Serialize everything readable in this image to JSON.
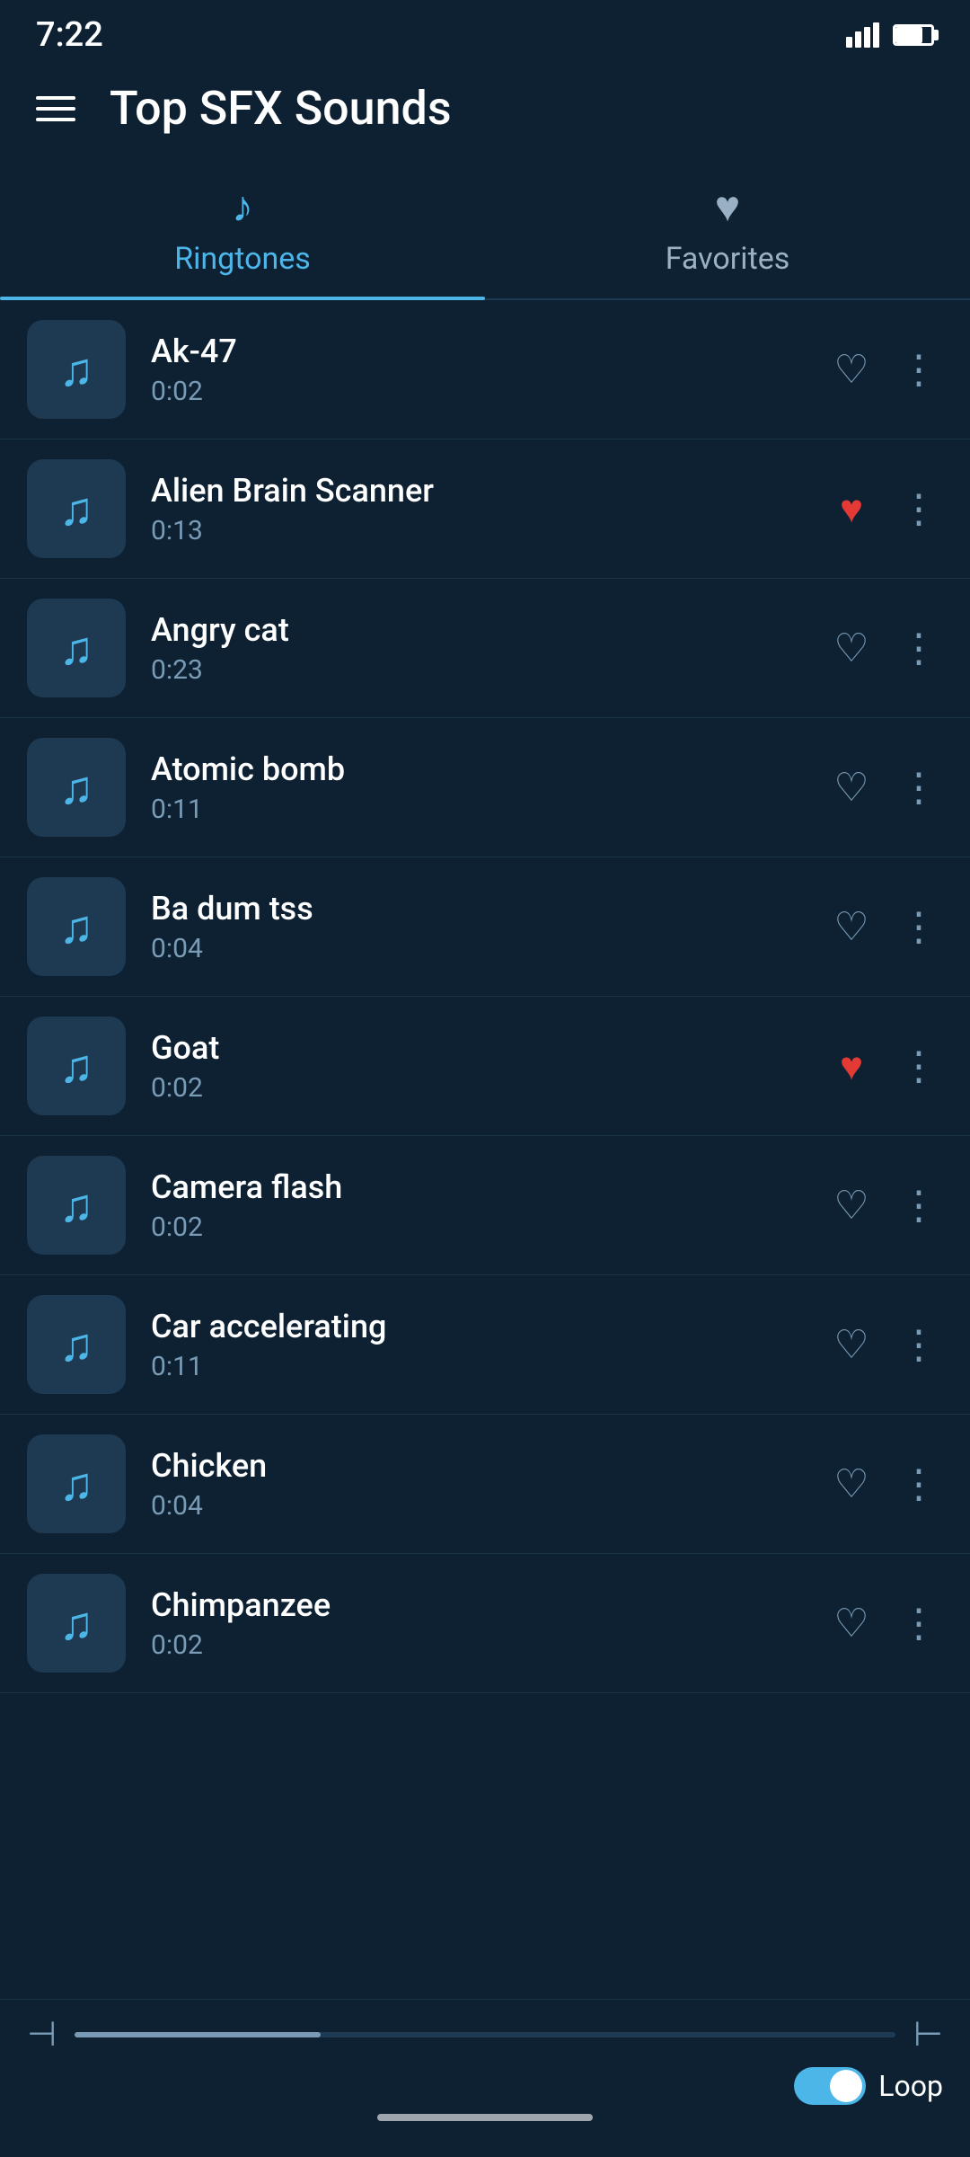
{
  "statusBar": {
    "time": "7:22"
  },
  "header": {
    "title": "Top SFX Sounds",
    "menuLabel": "menu"
  },
  "tabs": [
    {
      "id": "ringtones",
      "label": "Ringtones",
      "icon": "♪",
      "active": true
    },
    {
      "id": "favorites",
      "label": "Favorites",
      "icon": "♥",
      "active": false
    }
  ],
  "sounds": [
    {
      "name": "Ak-47",
      "duration": "0:02",
      "favorited": false
    },
    {
      "name": "Alien Brain Scanner",
      "duration": "0:13",
      "favorited": true
    },
    {
      "name": "Angry cat",
      "duration": "0:23",
      "favorited": false
    },
    {
      "name": "Atomic bomb",
      "duration": "0:11",
      "favorited": false
    },
    {
      "name": "Ba dum tss",
      "duration": "0:04",
      "favorited": false
    },
    {
      "name": "Goat",
      "duration": "0:02",
      "favorited": true
    },
    {
      "name": "Camera flash",
      "duration": "0:02",
      "favorited": false
    },
    {
      "name": "Car accelerating",
      "duration": "0:11",
      "favorited": false
    },
    {
      "name": "Chicken",
      "duration": "0:04",
      "favorited": false
    },
    {
      "name": "Chimpanzee",
      "duration": "0:02",
      "favorited": false
    }
  ],
  "player": {
    "skipBackLabel": "skip-back",
    "skipForwardLabel": "skip-forward",
    "progressPercent": 30,
    "loopLabel": "Loop",
    "loopEnabled": true
  }
}
